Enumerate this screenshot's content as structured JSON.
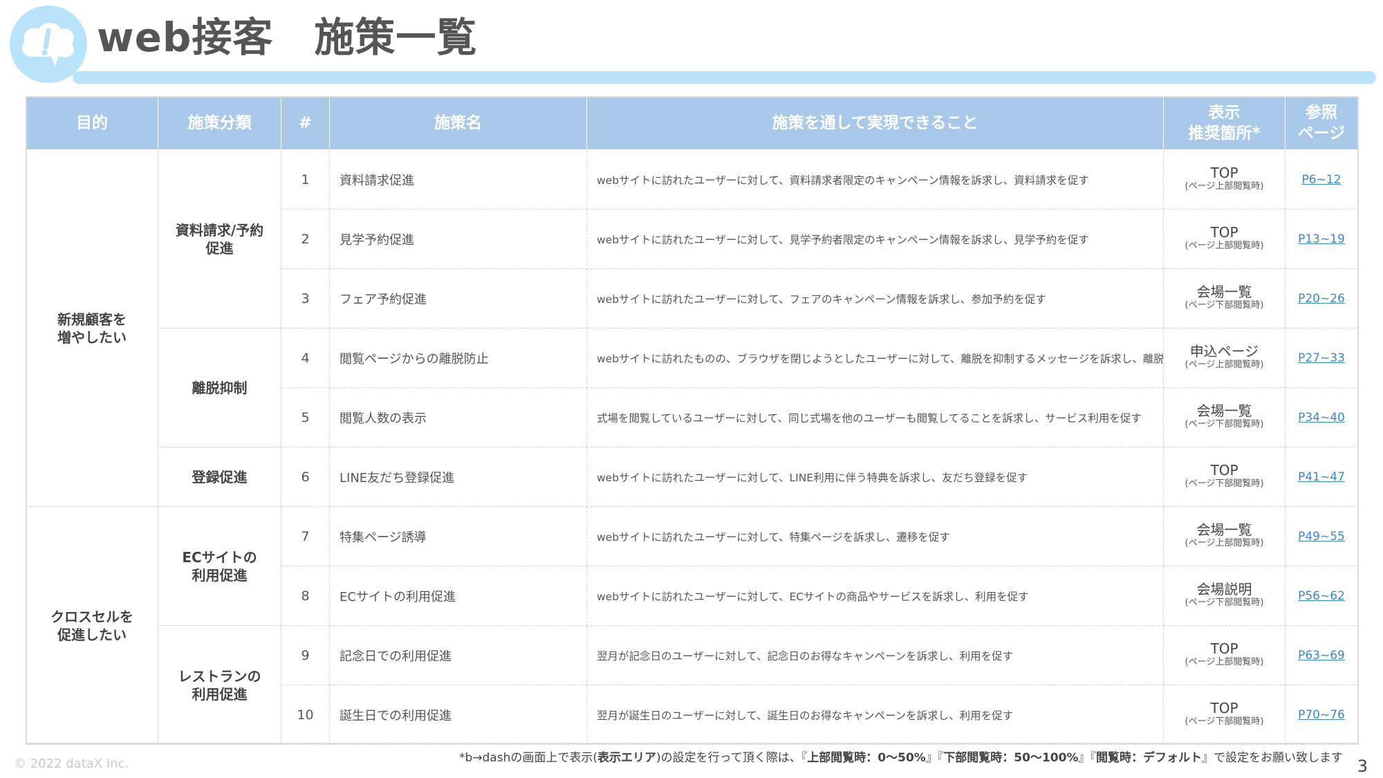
{
  "title": "web接客　施策一覧",
  "table": {
    "headers": {
      "purpose": "目的",
      "category": "施策分類",
      "number": "#",
      "name": "施策名",
      "description": "施策を通して実現できること",
      "placement_line1": "表示",
      "placement_line2": "推奨箇所*",
      "page_line1": "参照",
      "page_line2": "ページ"
    },
    "purposes": [
      {
        "line1": "新規顧客を",
        "line2": "増やしたい"
      },
      {
        "line1": "クロスセルを",
        "line2": "促進したい"
      }
    ],
    "categories": [
      {
        "line1": "資料請求/予約",
        "line2": "促進"
      },
      {
        "line1": "離脱抑制",
        "line2": ""
      },
      {
        "line1": "登録促進",
        "line2": ""
      },
      {
        "line1": "ECサイトの",
        "line2": "利用促進"
      },
      {
        "line1": "レストランの",
        "line2": "利用促進"
      }
    ],
    "rows": [
      {
        "num": "1",
        "name": "資料請求促進",
        "desc": "webサイトに訪れたユーザーに対して、資料請求者限定のキャンペーン情報を訴求し、資料請求を促す",
        "place": "TOP",
        "place_sub": "(ページ上部閲覧時)",
        "page": "P6~12"
      },
      {
        "num": "2",
        "name": "見学予約促進",
        "desc": "webサイトに訪れたユーザーに対して、見学予約者限定のキャンペーン情報を訴求し、見学予約を促す",
        "place": "TOP",
        "place_sub": "(ページ上部閲覧時)",
        "page": "P13~19"
      },
      {
        "num": "3",
        "name": "フェア予約促進",
        "desc": "webサイトに訪れたユーザーに対して、フェアのキャンペーン情報を訴求し、参加予約を促す",
        "place": "会場一覧",
        "place_sub": "(ページ下部閲覧時)",
        "page": "P20~26"
      },
      {
        "num": "4",
        "name": "閲覧ページからの離脱防止",
        "desc": "webサイトに訪れたものの、ブラウザを閉じようとしたユーザーに対して、離脱を抑制するメッセージを訴求し、離脱防止を促す",
        "place": "申込ページ",
        "place_sub": "(ページ上部閲覧時)",
        "page": "P27~33"
      },
      {
        "num": "5",
        "name": "閲覧人数の表示",
        "desc": "式場を閲覧しているユーザーに対して、同じ式場を他のユーザーも閲覧してることを訴求し、サービス利用を促す",
        "place": "会場一覧",
        "place_sub": "(ページ下部閲覧時)",
        "page": "P34~40"
      },
      {
        "num": "6",
        "name": "LINE友だち登録促進",
        "desc": "webサイトに訪れたユーザーに対して、LINE利用に伴う特典を訴求し、友だち登録を促す",
        "place": "TOP",
        "place_sub": "(ページ下部閲覧時)",
        "page": "P41~47"
      },
      {
        "num": "7",
        "name": "特集ページ誘導",
        "desc": "webサイトに訪れたユーザーに対して、特集ページを訴求し、遷移を促す",
        "place": "会場一覧",
        "place_sub": "(ページ上部閲覧時)",
        "page": "P49~55"
      },
      {
        "num": "8",
        "name": "ECサイトの利用促進",
        "desc": "webサイトに訪れたユーザーに対して、ECサイトの商品やサービスを訴求し、利用を促す",
        "place": "会場説明",
        "place_sub": "(ページ下部閲覧時)",
        "page": "P56~62"
      },
      {
        "num": "9",
        "name": "記念日での利用促進",
        "desc": "翌月が記念日のユーザーに対して、記念日のお得なキャンペーンを訴求し、利用を促す",
        "place": "TOP",
        "place_sub": "(ページ上部閲覧時)",
        "page": "P63~69"
      },
      {
        "num": "10",
        "name": "誕生日での利用促進",
        "desc": "翌月が誕生日のユーザーに対して、誕生日のお得なキャンペーンを訴求し、利用を促す",
        "place": "TOP",
        "place_sub": "(ページ下部閲覧時)",
        "page": "P70~76"
      }
    ]
  },
  "footnote": {
    "part1": "*b→dashの画面上で表示(",
    "bold1": "表示エリア",
    "part2": ")の設定を行って頂く際は、『",
    "bold2": "上部閲覧時：0〜50%",
    "part3": "』『",
    "bold3": "下部閲覧時：50〜100%",
    "part4": "』『",
    "bold4": "閲覧時：デフォルト",
    "part5": "』で設定をお願い致します"
  },
  "copyright": "© 2022 dataX Inc.",
  "page_number": "3",
  "colors": {
    "header_fill": "#a8c9ea",
    "accent_bar": "#b9e3fb",
    "link": "#3a86d6"
  },
  "icons": {
    "logo": "cloud-exclamation-icon"
  }
}
